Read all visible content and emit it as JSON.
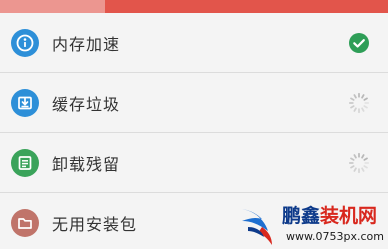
{
  "progress": {
    "fraction": 0.27,
    "fill_color": "#ec9690",
    "track_color": "#e2554b"
  },
  "items": [
    {
      "label": "内存加速",
      "icon": "memory-speed-icon",
      "icon_color": "#2d8fd8",
      "status": "done"
    },
    {
      "label": "缓存垃圾",
      "icon": "cache-download-icon",
      "icon_color": "#2d8fd8",
      "status": "scanning"
    },
    {
      "label": "卸载残留",
      "icon": "uninstall-note-icon",
      "icon_color": "#3aa35a",
      "status": "scanning"
    },
    {
      "label": "无用安装包",
      "icon": "folder-icon",
      "icon_color": "#c0746a",
      "status": "idle"
    }
  ],
  "status_colors": {
    "done": "#2e9e57",
    "scanning": "#b5b5b5"
  },
  "watermark": {
    "title_part1": "鹏鑫",
    "title_part2": "装机网",
    "url": "www.0753px.com"
  }
}
